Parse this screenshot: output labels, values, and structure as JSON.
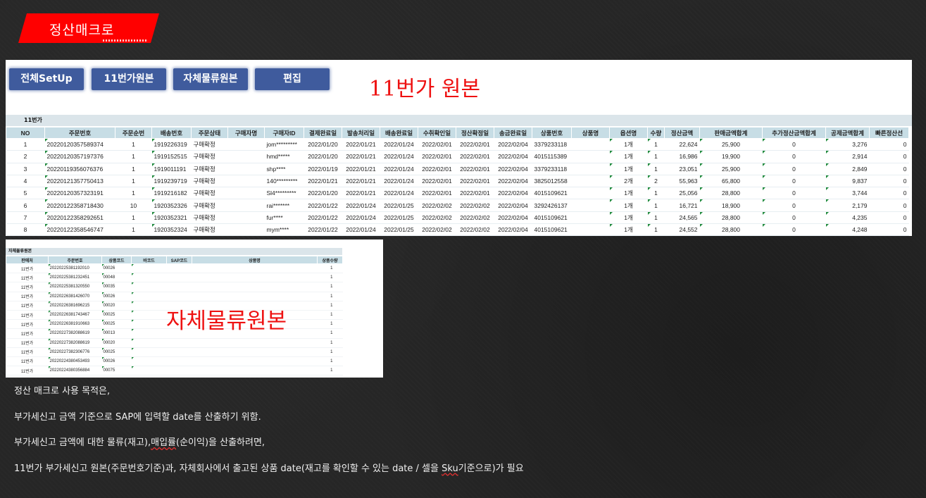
{
  "page_title": "정산매크로",
  "top_panel": {
    "buttons": [
      "전체SetUp",
      "11번가원본",
      "자체물류원본",
      "편집"
    ],
    "big_label": "11번가 원본",
    "sheet_name": "11번가",
    "headers": [
      "NO",
      "주문번호",
      "주문순번",
      "배송번호",
      "주문상태",
      "구매자명",
      "구매자ID",
      "결제완료일",
      "발송처리일",
      "배송완료일",
      "수취확인일",
      "정산확정일",
      "송금완료일",
      "상품번호",
      "상품명",
      "옵션명",
      "수량",
      "정산금액",
      "판매금액합계",
      "추가정산금액합계",
      "공제금액합계",
      "빠른정산선"
    ],
    "rows": [
      [
        "1",
        "20220120357589374",
        "1",
        "1919226319",
        "구매확정",
        "",
        "jom*********",
        "2022/01/20",
        "2022/01/21",
        "2022/01/24",
        "2022/02/01",
        "2022/02/01",
        "2022/02/04",
        "3379233118",
        "",
        "1개",
        "1",
        "22,624",
        "25,900",
        "0",
        "3,276",
        "0"
      ],
      [
        "2",
        "20220120357197376",
        "1",
        "1919152515",
        "구매확정",
        "",
        "hmd*****",
        "2022/01/20",
        "2022/01/21",
        "2022/01/24",
        "2022/02/01",
        "2022/02/01",
        "2022/02/04",
        "4015115389",
        "",
        "1개",
        "1",
        "16,986",
        "19,900",
        "0",
        "2,914",
        "0"
      ],
      [
        "3",
        "20220119356076376",
        "1",
        "1919011191",
        "구매확정",
        "",
        "shp****",
        "2022/01/19",
        "2022/01/21",
        "2022/01/24",
        "2022/02/01",
        "2022/02/01",
        "2022/02/04",
        "3379233118",
        "",
        "1개",
        "1",
        "23,051",
        "25,900",
        "0",
        "2,849",
        "0"
      ],
      [
        "4",
        "20220121357750413",
        "1",
        "1919239719",
        "구매확정",
        "",
        "140*********",
        "2022/01/21",
        "2022/01/21",
        "2022/01/24",
        "2022/02/01",
        "2022/02/01",
        "2022/02/04",
        "3825012558",
        "",
        "2개",
        "2",
        "55,963",
        "65,800",
        "0",
        "9,837",
        "0"
      ],
      [
        "5",
        "20220120357323191",
        "1",
        "1919216182",
        "구매확정",
        "",
        "Sl4*********",
        "2022/01/20",
        "2022/01/21",
        "2022/01/24",
        "2022/02/01",
        "2022/02/01",
        "2022/02/04",
        "4015109621",
        "",
        "1개",
        "1",
        "25,056",
        "28,800",
        "0",
        "3,744",
        "0"
      ],
      [
        "6",
        "20220122358718430",
        "10",
        "1920352326",
        "구매확정",
        "",
        "rai*******",
        "2022/01/22",
        "2022/01/24",
        "2022/01/25",
        "2022/02/02",
        "2022/02/02",
        "2022/02/04",
        "3292426137",
        "",
        "1개",
        "1",
        "16,721",
        "18,900",
        "0",
        "2,179",
        "0"
      ],
      [
        "7",
        "20220122358292651",
        "1",
        "1920352321",
        "구매확정",
        "",
        "fur****",
        "2022/01/22",
        "2022/01/24",
        "2022/01/25",
        "2022/02/02",
        "2022/02/02",
        "2022/02/04",
        "4015109621",
        "",
        "1개",
        "1",
        "24,565",
        "28,800",
        "0",
        "4,235",
        "0"
      ],
      [
        "8",
        "20220122358546747",
        "1",
        "1920352324",
        "구매확정",
        "",
        "mym****",
        "2022/01/22",
        "2022/01/24",
        "2022/01/25",
        "2022/02/02",
        "2022/02/02",
        "2022/02/04",
        "4015109621",
        "",
        "1개",
        "1",
        "24,552",
        "28,800",
        "0",
        "4,248",
        "0"
      ]
    ]
  },
  "bottom_panel": {
    "big_label": "자체물류원본",
    "sheet_name": "자체물류원본",
    "headers": [
      "판매처",
      "주문번호",
      "상품코드",
      "바코드",
      "SAP코드",
      "상품명",
      "상품수량"
    ],
    "rows": [
      [
        "11번가",
        "20220225381192010",
        "00026",
        "",
        "",
        "",
        "1"
      ],
      [
        "11번가",
        "20220225381232451",
        "00048",
        "",
        "",
        "",
        "1"
      ],
      [
        "11번가",
        "20220225381320550",
        "00035",
        "",
        "",
        "",
        "1"
      ],
      [
        "11번가",
        "20220226381426070",
        "00026",
        "",
        "",
        "",
        "1"
      ],
      [
        "11번가",
        "20220226381696215",
        "00020",
        "",
        "",
        "",
        "1"
      ],
      [
        "11번가",
        "20220226381743467",
        "00025",
        "",
        "",
        "",
        "1"
      ],
      [
        "11번가",
        "20220226381910663",
        "00025",
        "",
        "",
        "",
        "1"
      ],
      [
        "11번가",
        "20220227382088619",
        "00013",
        "",
        "",
        "",
        "1"
      ],
      [
        "11번가",
        "20220227382088619",
        "00020",
        "",
        "",
        "",
        "1"
      ],
      [
        "11번가",
        "20220227382306776",
        "00025",
        "",
        "",
        "",
        "1"
      ],
      [
        "11번가",
        "20220224380453493",
        "00026",
        "",
        "",
        "",
        "1"
      ],
      [
        "11번가",
        "20220224380356884",
        "00075",
        "",
        "",
        "",
        "1"
      ]
    ]
  },
  "notes": {
    "line1": "정산 매크로 사용 목적은,",
    "line2": "부가세신고 금액 기준으로 SAP에 입력할 date를 산출하기 위함.",
    "line3_a": "부가세신고 금액에 대한 물류(재고),",
    "line3_b": "매입률",
    "line3_c": "(순이익)을 산출하려면,",
    "line4_a": "11번가 부가세신고 원본(주문번호기준)과, 자체회사에서 출고된 상품 date(재고를 확인할 수 있는 date / 셀을 ",
    "line4_b": "Sku",
    "line4_c": "기준으로)가 필요"
  }
}
